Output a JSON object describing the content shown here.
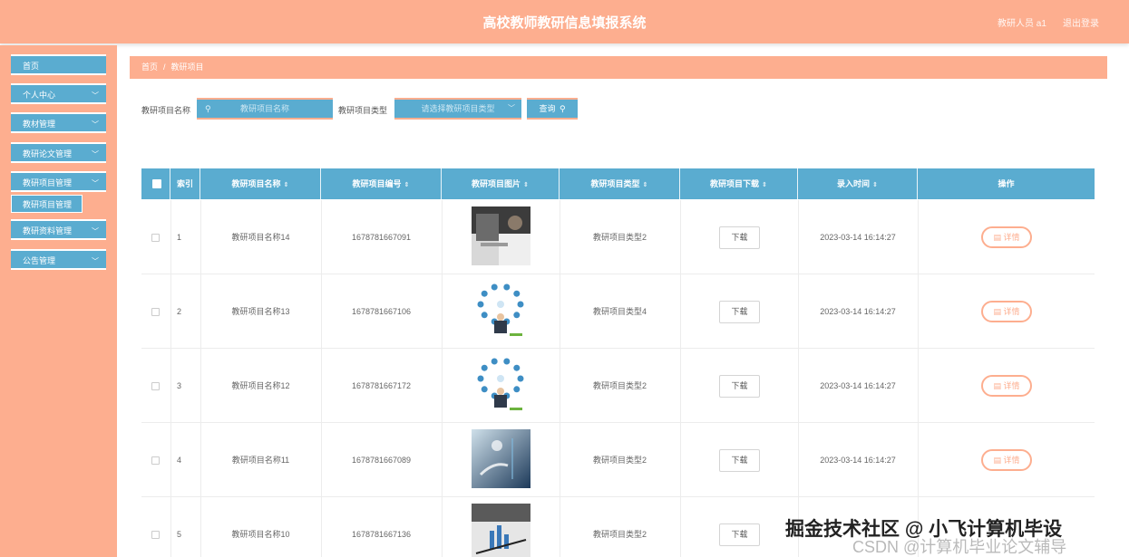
{
  "header": {
    "title": "高校教师教研信息填报系统",
    "user": "教研人员 a1",
    "logout": "退出登录"
  },
  "sidebar": {
    "items": [
      {
        "label": "首页",
        "chevron": ""
      },
      {
        "label": "个人中心",
        "chevron": "﹀"
      },
      {
        "label": "教材管理",
        "chevron": "﹀"
      },
      {
        "label": "教研论文管理",
        "chevron": "﹀"
      },
      {
        "label": "教研项目管理",
        "chevron": "﹀"
      },
      {
        "label": "教研资料管理",
        "chevron": "﹀"
      },
      {
        "label": "公告管理",
        "chevron": "﹀"
      }
    ],
    "subitem": "教研项目管理"
  },
  "breadcrumb": {
    "home": "首页",
    "sep": "/",
    "current": "教研项目"
  },
  "search": {
    "name_label": "教研项目名称",
    "name_placeholder": "教研项目名称",
    "type_label": "教研项目类型",
    "type_placeholder": "请选择教研项目类型",
    "button": "查询"
  },
  "table": {
    "columns": [
      "索引",
      "教研项目名称",
      "教研项目编号",
      "教研项目图片",
      "教研项目类型",
      "教研项目下载",
      "录入时间",
      "操作"
    ],
    "sort_glyph": "⇕",
    "rows": [
      {
        "index": "1",
        "name": "教研项目名称14",
        "code": "1678781667091",
        "image": "office-photo",
        "type": "教研项目类型2",
        "download": "下载",
        "time": "2023-03-14 16:14:27",
        "action": "详情"
      },
      {
        "index": "2",
        "name": "教研项目名称13",
        "code": "1678781667106",
        "image": "network-person-graphic",
        "type": "教研项目类型4",
        "download": "下载",
        "time": "2023-03-14 16:14:27",
        "action": "详情"
      },
      {
        "index": "3",
        "name": "教研项目名称12",
        "code": "1678781667172",
        "image": "network-person-graphic",
        "type": "教研项目类型2",
        "download": "下载",
        "time": "2023-03-14 16:14:27",
        "action": "详情"
      },
      {
        "index": "4",
        "name": "教研项目名称11",
        "code": "1678781667089",
        "image": "tech-hand-photo",
        "type": "教研项目类型2",
        "download": "下载",
        "time": "2023-03-14 16:14:27",
        "action": "详情"
      },
      {
        "index": "5",
        "name": "教研项目名称10",
        "code": "1678781667136",
        "image": "chart-paper-photo",
        "type": "教研项目类型2",
        "download": "下载",
        "time": "",
        "action": ""
      }
    ]
  },
  "watermark": {
    "line1": "掘金技术社区 @ 小飞计算机毕设",
    "line2": "CSDN @计算机毕业论文辅导"
  },
  "colors": {
    "accent": "#fdae8f",
    "primary": "#5aacd0"
  }
}
